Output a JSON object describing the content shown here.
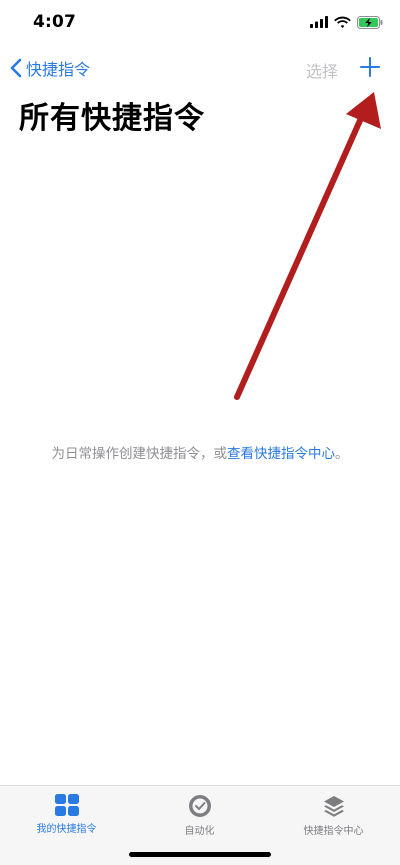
{
  "status_bar": {
    "time": "4:07",
    "icons": [
      "cellular-signal-icon",
      "wifi-icon",
      "battery-charging-icon"
    ]
  },
  "nav": {
    "back_label": "快捷指令",
    "select_label": "选择",
    "add_icon": "plus-icon"
  },
  "page_title": "所有快捷指令",
  "empty_state": {
    "text_before": "为日常操作创建快捷指令，或",
    "link_text": "查看快捷指令中心",
    "text_after": "。"
  },
  "tab_bar": {
    "tabs": [
      {
        "label": "我的快捷指令",
        "icon": "grid-icon",
        "active": true
      },
      {
        "label": "自动化",
        "icon": "clock-check-icon",
        "active": false
      },
      {
        "label": "快捷指令中心",
        "icon": "layers-icon",
        "active": false
      }
    ]
  },
  "colors": {
    "accent": "#2a7ae4",
    "disabled": "#c2c2c6",
    "secondary_text": "#8e8e93",
    "annotation_arrow": "#b21d1d"
  }
}
